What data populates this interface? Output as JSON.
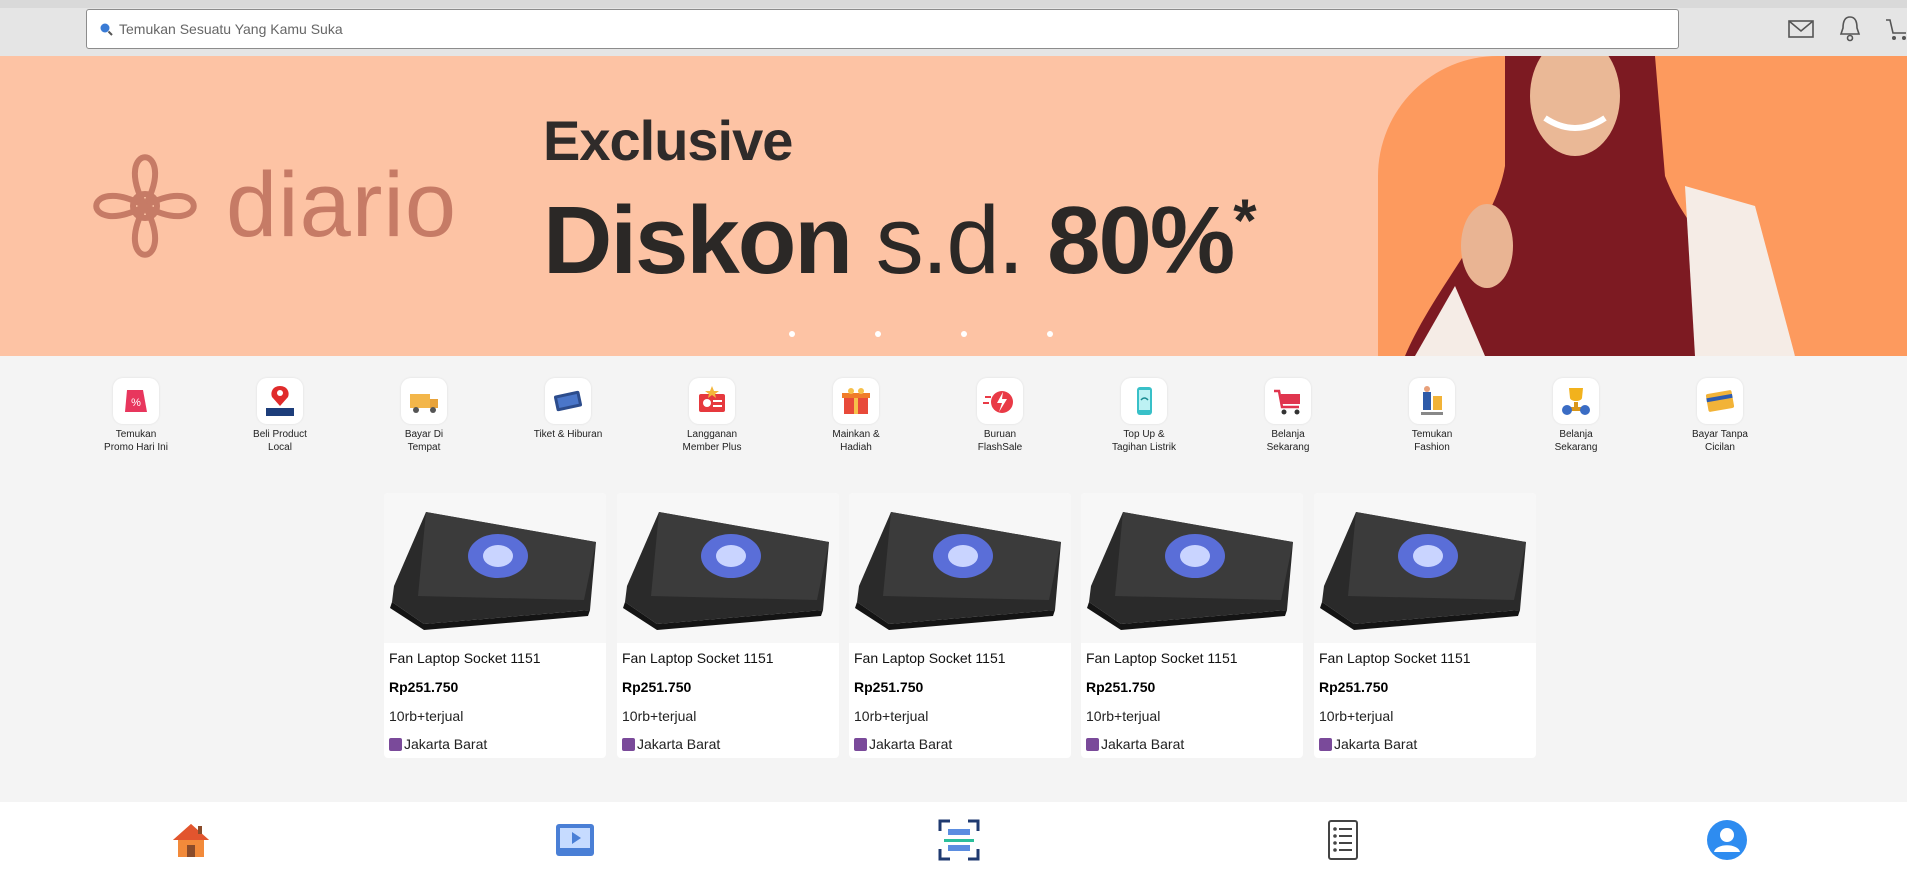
{
  "search": {
    "placeholder": "Temukan Sesuatu Yang Kamu Suka"
  },
  "banner": {
    "brand": "diario",
    "headline1": "Exclusive",
    "headline2_a": "Diskon",
    "headline2_b": "s.d.",
    "headline2_c": "80%",
    "headline2_star": "*",
    "slide_count": 4
  },
  "categories": [
    {
      "label": "Temukan\nPromo Hari Ini",
      "icon": "promo-icon"
    },
    {
      "label": "Beli Product\nLocal",
      "icon": "local-icon"
    },
    {
      "label": "Bayar Di\nTempat",
      "icon": "cod-truck-icon"
    },
    {
      "label": "Tiket & Hiburan",
      "icon": "ticket-icon"
    },
    {
      "label": "Langganan\nMember Plus",
      "icon": "member-card-icon"
    },
    {
      "label": "Mainkan &\nHadiah",
      "icon": "gift-icon"
    },
    {
      "label": "Buruan\nFlashSale",
      "icon": "flashsale-icon"
    },
    {
      "label": "Top Up &\nTagihan Listrik",
      "icon": "topup-phone-icon"
    },
    {
      "label": "Belanja\nSekarang",
      "icon": "shopping-cart-icon"
    },
    {
      "label": "Temukan\nFashion",
      "icon": "fashion-icon"
    },
    {
      "label": "Belanja\nSekarang",
      "icon": "trophy-icon"
    },
    {
      "label": "Bayar Tanpa\nCicilan",
      "icon": "credit-card-icon"
    }
  ],
  "products": [
    {
      "name": "Fan Laptop Socket 1151",
      "price": "Rp251.750",
      "sold": "10rb+terjual",
      "location": "Jakarta Barat"
    },
    {
      "name": "Fan Laptop Socket 1151",
      "price": "Rp251.750",
      "sold": "10rb+terjual",
      "location": "Jakarta Barat"
    },
    {
      "name": "Fan Laptop Socket 1151",
      "price": "Rp251.750",
      "sold": "10rb+terjual",
      "location": "Jakarta Barat"
    },
    {
      "name": "Fan Laptop Socket 1151",
      "price": "Rp251.750",
      "sold": "10rb+terjual",
      "location": "Jakarta Barat"
    },
    {
      "name": "Fan Laptop Socket 1151",
      "price": "Rp251.750",
      "sold": "10rb+terjual",
      "location": "Jakarta Barat"
    }
  ],
  "top_icons": [
    "mail-icon",
    "bell-icon",
    "cart-icon"
  ],
  "bottom_nav": [
    "home-icon",
    "video-icon",
    "scan-icon",
    "orders-icon",
    "profile-icon"
  ],
  "colors": {
    "banner_bg": "#fdc3a4",
    "banner_accent": "#fd9a5e",
    "brand": "#c67b66"
  }
}
